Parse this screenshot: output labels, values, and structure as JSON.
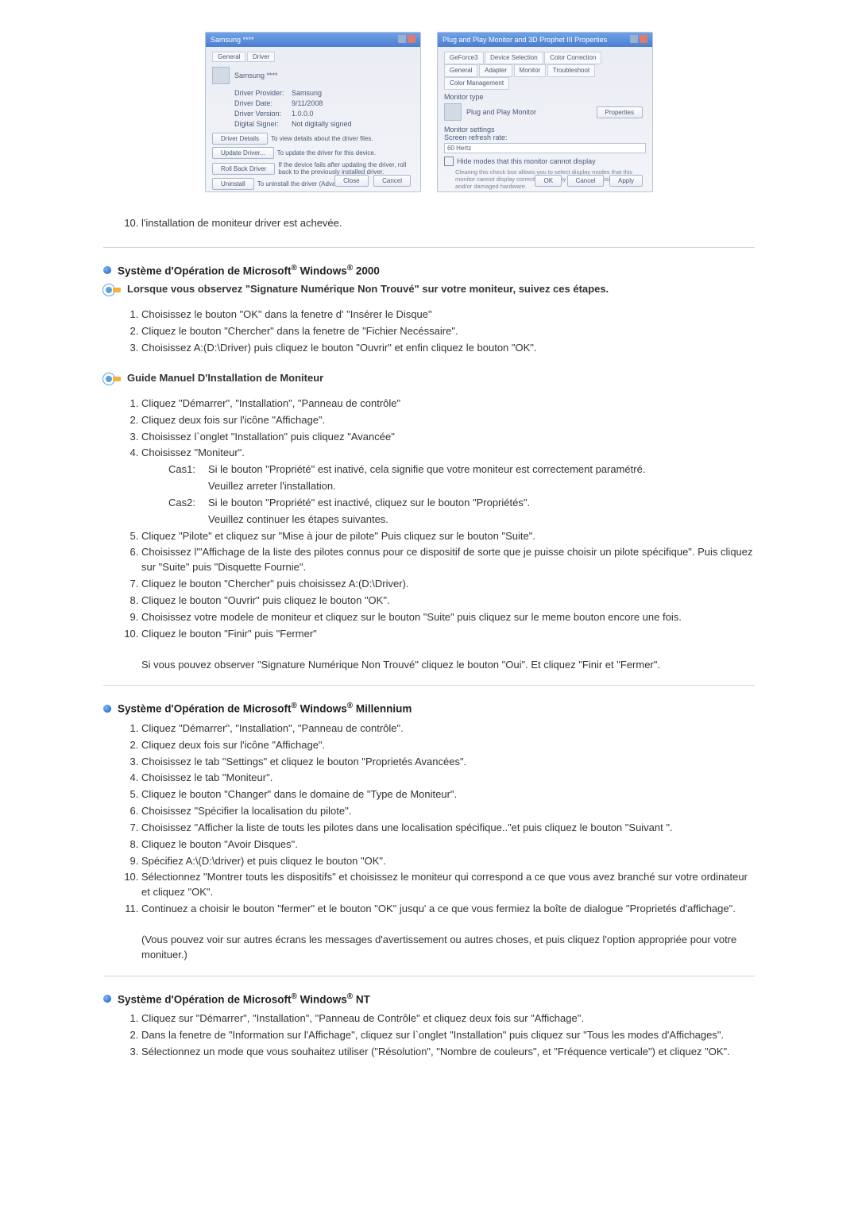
{
  "screenshots": {
    "left": {
      "title": "Samsung ****",
      "tab1": "General",
      "tab2": "Driver",
      "deviceName": "Samsung ****",
      "rows": {
        "provider_k": "Driver Provider:",
        "provider_v": "Samsung",
        "date_k": "Driver Date:",
        "date_v": "9/11/2008",
        "version_k": "Driver Version:",
        "version_v": "1.0.0.0",
        "signer_k": "Digital Signer:",
        "signer_v": "Not digitally signed"
      },
      "btn_details": "Driver Details",
      "btn_details_d": "To view details about the driver files.",
      "btn_update": "Update Driver...",
      "btn_update_d": "To update the driver for this device.",
      "btn_rollback": "Roll Back Driver",
      "btn_rollback_d": "If the device fails after updating the driver, roll back to the previously installed driver.",
      "btn_uninstall": "Uninstall",
      "btn_uninstall_d": "To uninstall the driver (Advanced).",
      "close": "Close",
      "cancel": "Cancel"
    },
    "right": {
      "title": "Plug and Play Monitor and 3D Prophet III Properties",
      "tabs": [
        "GeForce3",
        "Device Selection",
        "Color Correction",
        "General",
        "Adapter",
        "Monitor",
        "Troubleshoot",
        "Color Management"
      ],
      "monitor_type": "Monitor type",
      "monitor_name": "Plug and Play Monitor",
      "properties": "Properties",
      "settings": "Monitor settings",
      "refresh_label": "Screen refresh rate:",
      "refresh_value": "60 Hertz",
      "check_label": "Hide modes that this monitor cannot display",
      "check_note": "Clearing this check box allows you to select display modes that this monitor cannot display correctly. This may lead to an unusable display and/or damaged hardware.",
      "ok": "OK",
      "cancel": "Cancel",
      "apply": "Apply"
    }
  },
  "continued": {
    "item10": "l'installation de moniteur driver est achevée."
  },
  "win2000": {
    "heading": "Système d'Opération de Microsoft® Windows® 2000",
    "warn": "Lorsque vous observez \"Signature Numérique Non Trouvé\" sur votre moniteur, suivez ces étapes.",
    "warn_steps": [
      "Choisissez le bouton \"OK\" dans la fenetre d' \"Insérer le Disque\"",
      "Cliquez le bouton \"Chercher\" dans la fenetre de \"Fichier Necéssaire\".",
      "Choisissez A:(D:\\Driver) puis cliquez le bouton \"Ouvrir\" et enfin cliquez le bouton \"OK\"."
    ],
    "guide_heading": "Guide Manuel D'Installation de Moniteur",
    "guide_steps": [
      "Cliquez \"Démarrer\", \"Installation\", \"Panneau de contrôle\"",
      "Cliquez deux fois sur l'icône \"Affichage\".",
      "Choisissez l`onglet \"Installation\" puis cliquez \"Avancée\"",
      "Choisissez \"Moniteur\"."
    ],
    "cas1_k": "Cas1:",
    "cas1_a": "Si le bouton \"Propriété\" est inativé, cela signifie que votre moniteur est correctement paramétré.",
    "cas1_b": "Veuillez arreter l'installation.",
    "cas2_k": "Cas2:",
    "cas2_a": "Si le bouton \"Propriété\" est inactivé, cliquez sur le bouton \"Propriétés\".",
    "cas2_b": "Veuillez continuer les étapes suivantes.",
    "guide_steps_b": [
      "Cliquez \"Pilote\" et cliquez sur \"Mise à jour de pilote\" Puis cliquez sur le bouton \"Suite\".",
      "Choisissez l'\"Affichage de la liste des pilotes connus pour ce dispositif de sorte que je puisse choisir un pilote spécifique\". Puis cliquez sur \"Suite\" puis \"Disquette Fournie\".",
      "Cliquez le bouton \"Chercher\" puis choisissez A:(D:\\Driver).",
      "Cliquez le bouton \"Ouvrir\" puis cliquez le bouton \"OK\".",
      "Choisissez votre modele de moniteur et cliquez sur le bouton \"Suite\" puis cliquez sur le meme bouton encore une fois.",
      "Cliquez le bouton \"Finir\" puis \"Fermer\""
    ],
    "note": "Si vous pouvez observer \"Signature Numérique Non Trouvé\" cliquez le bouton \"Oui\". Et cliquez \"Finir et \"Fermer\"."
  },
  "winme": {
    "heading": "Système d'Opération de Microsoft® Windows® Millennium",
    "steps": [
      "Cliquez \"Démarrer\", \"Installation\", \"Panneau de contrôle\".",
      "Cliquez deux fois sur l'icône \"Affichage\".",
      "Choisissez le tab \"Settings\" et cliquez le bouton \"Proprietés Avancées\".",
      "Choisissez le tab \"Moniteur\".",
      "Cliquez le bouton \"Changer\" dans le domaine de \"Type de Moniteur\".",
      "Choisissez \"Spécifier la localisation du pilote\".",
      "Choisissez \"Afficher la liste de touts les pilotes dans une localisation spécifique..\"et puis cliquez le bouton \"Suivant \".",
      "Cliquez le bouton \"Avoir Disques\".",
      "Spécifiez A:\\(D:\\driver) et puis cliquez le bouton \"OK\".",
      "Sélectionnez \"Montrer touts les dispositifs\" et choisissez le moniteur qui correspond a ce que vous avez branché sur votre ordinateur et cliquez \"OK\".",
      "Continuez a choisir le bouton \"fermer\" et le bouton \"OK\" jusqu' a ce que vous fermiez la boîte de dialogue \"Proprietés d'affichage\"."
    ],
    "note": "(Vous pouvez voir sur autres écrans les messages d'avertissement ou autres choses, et puis cliquez l'option appropriée pour votre monituer.)"
  },
  "winnt": {
    "heading": "Système d'Opération de Microsoft® Windows® NT",
    "steps": [
      "Cliquez sur \"Démarrer\", \"Installation\", \"Panneau de Contrôle\" et cliquez deux fois sur \"Affichage\".",
      "Dans la fenetre de \"Information sur l'Affichage\", cliquez sur l`onglet \"Installation\" puis cliquez sur \"Tous les modes d'Affichages\".",
      "Sélectionnez un mode que vous souhaitez utiliser (\"Résolution\", \"Nombre de couleurs\", et \"Fréquence verticale\") et cliquez \"OK\"."
    ]
  }
}
